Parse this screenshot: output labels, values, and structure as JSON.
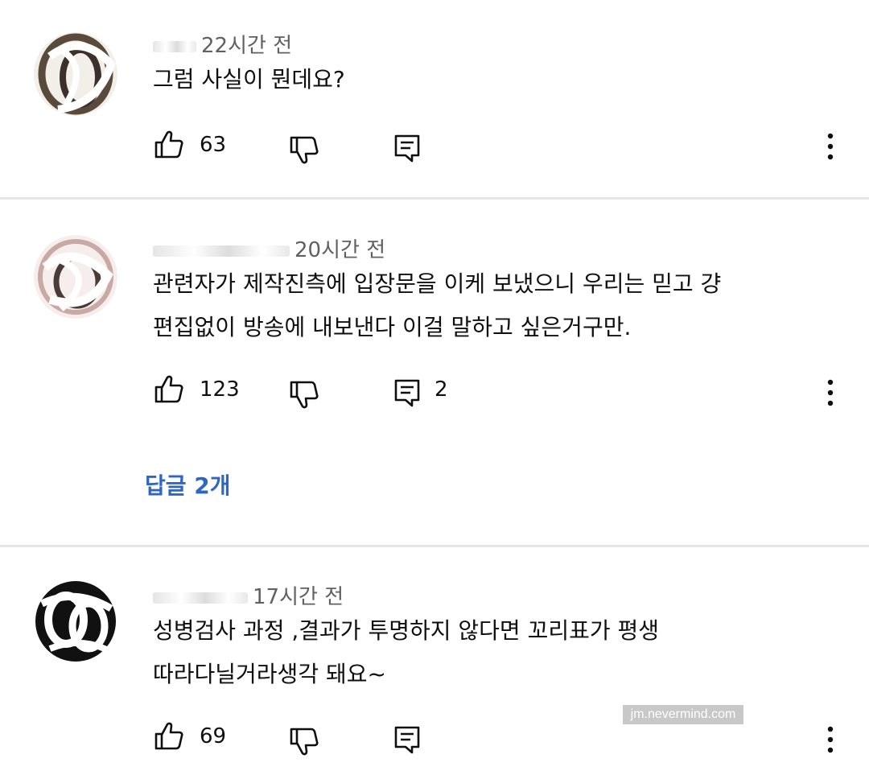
{
  "comments": [
    {
      "author": "",
      "time": "22시간 전",
      "lines": [
        "그럼 사실이 뭔데요?"
      ],
      "likes": "63",
      "reply_count": ""
    },
    {
      "author": "",
      "time": "20시간 전",
      "lines": [
        "관련자가 제작진측에 입장문을 이케 보냈으니 우리는 믿고 걍",
        "편집없이 방송에 내보낸다 이걸 말하고 싶은거구만."
      ],
      "likes": "123",
      "reply_count": "2",
      "replies_link": "답글 2개"
    },
    {
      "author": "",
      "time": "17시간 전",
      "lines": [
        "성병검사 과정 ,결과가 투명하지 않다면 꼬리표가 평생",
        "따라다닐거라생각 돼요~"
      ],
      "likes": "69",
      "reply_count": ""
    }
  ],
  "icons": {
    "like": "thumbs-up-icon",
    "dislike": "thumbs-down-icon",
    "reply": "reply-icon",
    "more": "more-vert-icon"
  },
  "colors": {
    "link": "#2f66c2",
    "meta": "#606060",
    "divider": "#e6e6e6"
  },
  "watermark": "jm.nevermind.com"
}
